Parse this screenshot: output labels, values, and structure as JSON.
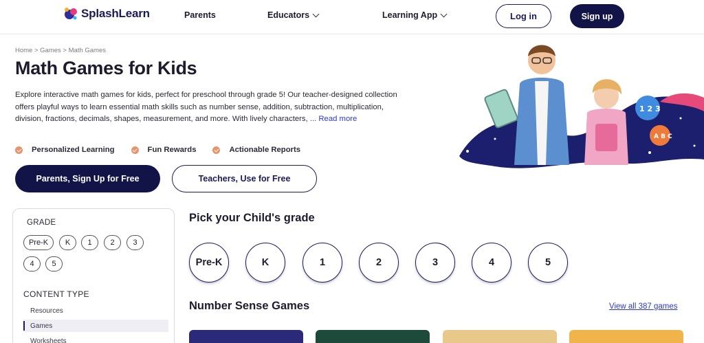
{
  "header": {
    "brand": "SplashLearn",
    "nav": [
      {
        "label": "Parents"
      },
      {
        "label": "Educators"
      },
      {
        "label": "Learning App"
      }
    ],
    "login_label": "Log in",
    "signup_label": "Sign up"
  },
  "breadcrumb": "Home > Games > Math Games",
  "hero": {
    "title": "Math Games for Kids",
    "description": "Explore interactive math games for kids, perfect for preschool through grade 5! Our teacher-designed collection offers playful ways to learn essential math skills such as number sense, addition, subtraction, multiplication, division, fractions, decimals, shapes, measurement, and more. With lively characters,",
    "read_more": "... Read more",
    "features": [
      "Personalized Learning",
      "Fun Rewards",
      "Actionable Reports"
    ],
    "cta_parents": "Parents, Sign Up for Free",
    "cta_teachers": "Teachers, Use for Free"
  },
  "sidebar": {
    "grade_heading": "GRADE",
    "grades": [
      "Pre-K",
      "K",
      "1",
      "2",
      "3",
      "4",
      "5"
    ],
    "content_heading": "CONTENT TYPE",
    "content_types": [
      {
        "label": "Resources",
        "active": false
      },
      {
        "label": "Games",
        "active": true
      },
      {
        "label": "Worksheets",
        "active": false
      }
    ]
  },
  "main": {
    "grade_title": "Pick your Child's grade",
    "grades": [
      "Pre-K",
      "K",
      "1",
      "2",
      "3",
      "4",
      "5"
    ],
    "section_title": "Number Sense Games",
    "view_all": "View all 387 games"
  },
  "colors": {
    "brand_navy": "#121346",
    "link_blue": "#2a37d6",
    "check_orange": "#e8946a"
  },
  "icons": {
    "feature_bullet": "check-circle-icon",
    "nav_dropdown": "chevron-down-icon"
  }
}
